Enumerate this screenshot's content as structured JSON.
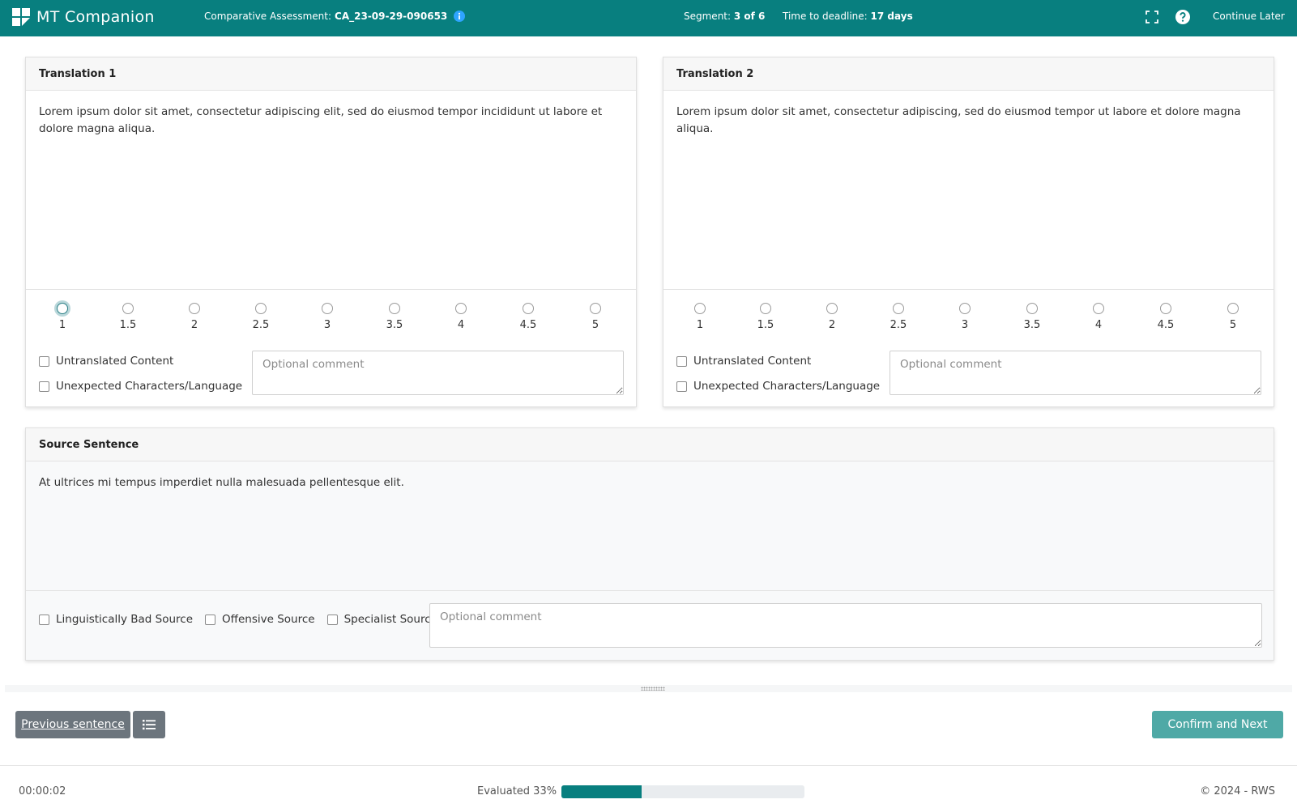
{
  "header": {
    "app_name": "MT Companion",
    "assessment_label": "Comparative Assessment:",
    "assessment_id": "CA_23-09-29-090653",
    "segment_label": "Segment:",
    "segment_value": "3 of 6",
    "deadline_label": "Time to deadline:",
    "deadline_value": "17 days",
    "continue_later": "Continue Later",
    "icons": [
      "logo-icon",
      "info-icon",
      "fullscreen-icon",
      "help-icon"
    ]
  },
  "translations": [
    {
      "title": "Translation 1",
      "text": "Lorem ipsum dolor sit amet, consectetur adipiscing elit, sed do eiusmod tempor incididunt ut labore et dolore magna aliqua.",
      "ratings": [
        "1",
        "1.5",
        "2",
        "2.5",
        "3",
        "3.5",
        "4",
        "4.5",
        "5"
      ],
      "focused_rating": "1",
      "flags": [
        "Untranslated Content",
        "Unexpected Characters/Language"
      ],
      "comment_placeholder": "Optional comment"
    },
    {
      "title": "Translation 2",
      "text": "Lorem ipsum dolor sit amet, consectetur adipiscing, sed do eiusmod tempor ut labore et dolore magna aliqua.",
      "ratings": [
        "1",
        "1.5",
        "2",
        "2.5",
        "3",
        "3.5",
        "4",
        "4.5",
        "5"
      ],
      "focused_rating": null,
      "flags": [
        "Untranslated Content",
        "Unexpected Characters/Language"
      ],
      "comment_placeholder": "Optional comment"
    }
  ],
  "source": {
    "title": "Source Sentence",
    "text": "At ultrices mi tempus imperdiet nulla malesuada pellentesque elit.",
    "flags": [
      "Linguistically Bad Source",
      "Offensive Source",
      "Specialist Source"
    ],
    "comment_placeholder": "Optional comment"
  },
  "nav": {
    "previous": "Previous sentence",
    "next": "Confirm and Next",
    "list_icon": "list-icon"
  },
  "footer": {
    "timer": "00:00:02",
    "progress_label": "Evaluated 33%",
    "progress_fraction": 0.33,
    "copyright": "© 2024 - RWS"
  },
  "colors": {
    "brand": "#087f7f",
    "confirm_button": "#4fa9a6",
    "secondary_button": "#6c757d"
  }
}
